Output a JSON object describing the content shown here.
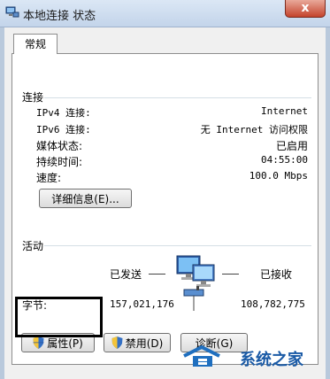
{
  "window": {
    "title": "本地连接 状态",
    "close_glyph": "x"
  },
  "tabs": [
    {
      "label": "常规"
    }
  ],
  "connection": {
    "heading": "连接",
    "rows": [
      {
        "label": "IPv4 连接:",
        "value": "Internet"
      },
      {
        "label": "IPv6 连接:",
        "value": "无 Internet 访问权限"
      },
      {
        "label": "媒体状态:",
        "value": "已启用"
      },
      {
        "label": "持续时间:",
        "value": "04:55:00"
      },
      {
        "label": "速度:",
        "value": "100.0 Mbps"
      }
    ],
    "details_button": "详细信息(E)..."
  },
  "activity": {
    "heading": "活动",
    "sent_label": "已发送",
    "received_label": "已接收",
    "bytes_label": "字节:",
    "bytes_sent": "157,021,176",
    "bytes_received": "108,782,775"
  },
  "buttons": {
    "properties": "属性(P)",
    "disable": "禁用(D)",
    "diagnose": "诊断(G)"
  },
  "watermark": {
    "text": "系统之家"
  },
  "colors": {
    "titlebar": "#c3d4ea",
    "close": "#c4432c",
    "highlight": "#000000"
  }
}
